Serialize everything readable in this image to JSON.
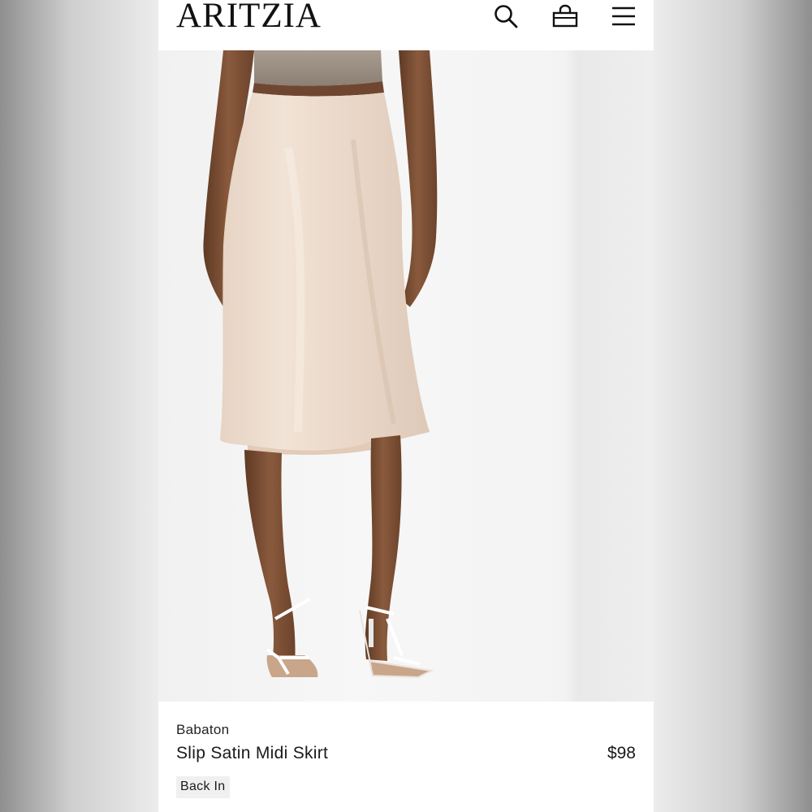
{
  "header": {
    "logo": "ARITZIA",
    "icons": [
      "search-icon",
      "shopping-bag-icon",
      "hamburger-menu-icon"
    ]
  },
  "product": {
    "brand": "Babaton",
    "name": "Slip Satin Midi Skirt",
    "price": "$98",
    "badge": "Back In",
    "image": "product-photo"
  },
  "colors": {
    "skirt": "#ecdccd",
    "background": "#f4f4f4",
    "text": "#1a1a1a",
    "badge_bg": "#f0f0f0"
  }
}
